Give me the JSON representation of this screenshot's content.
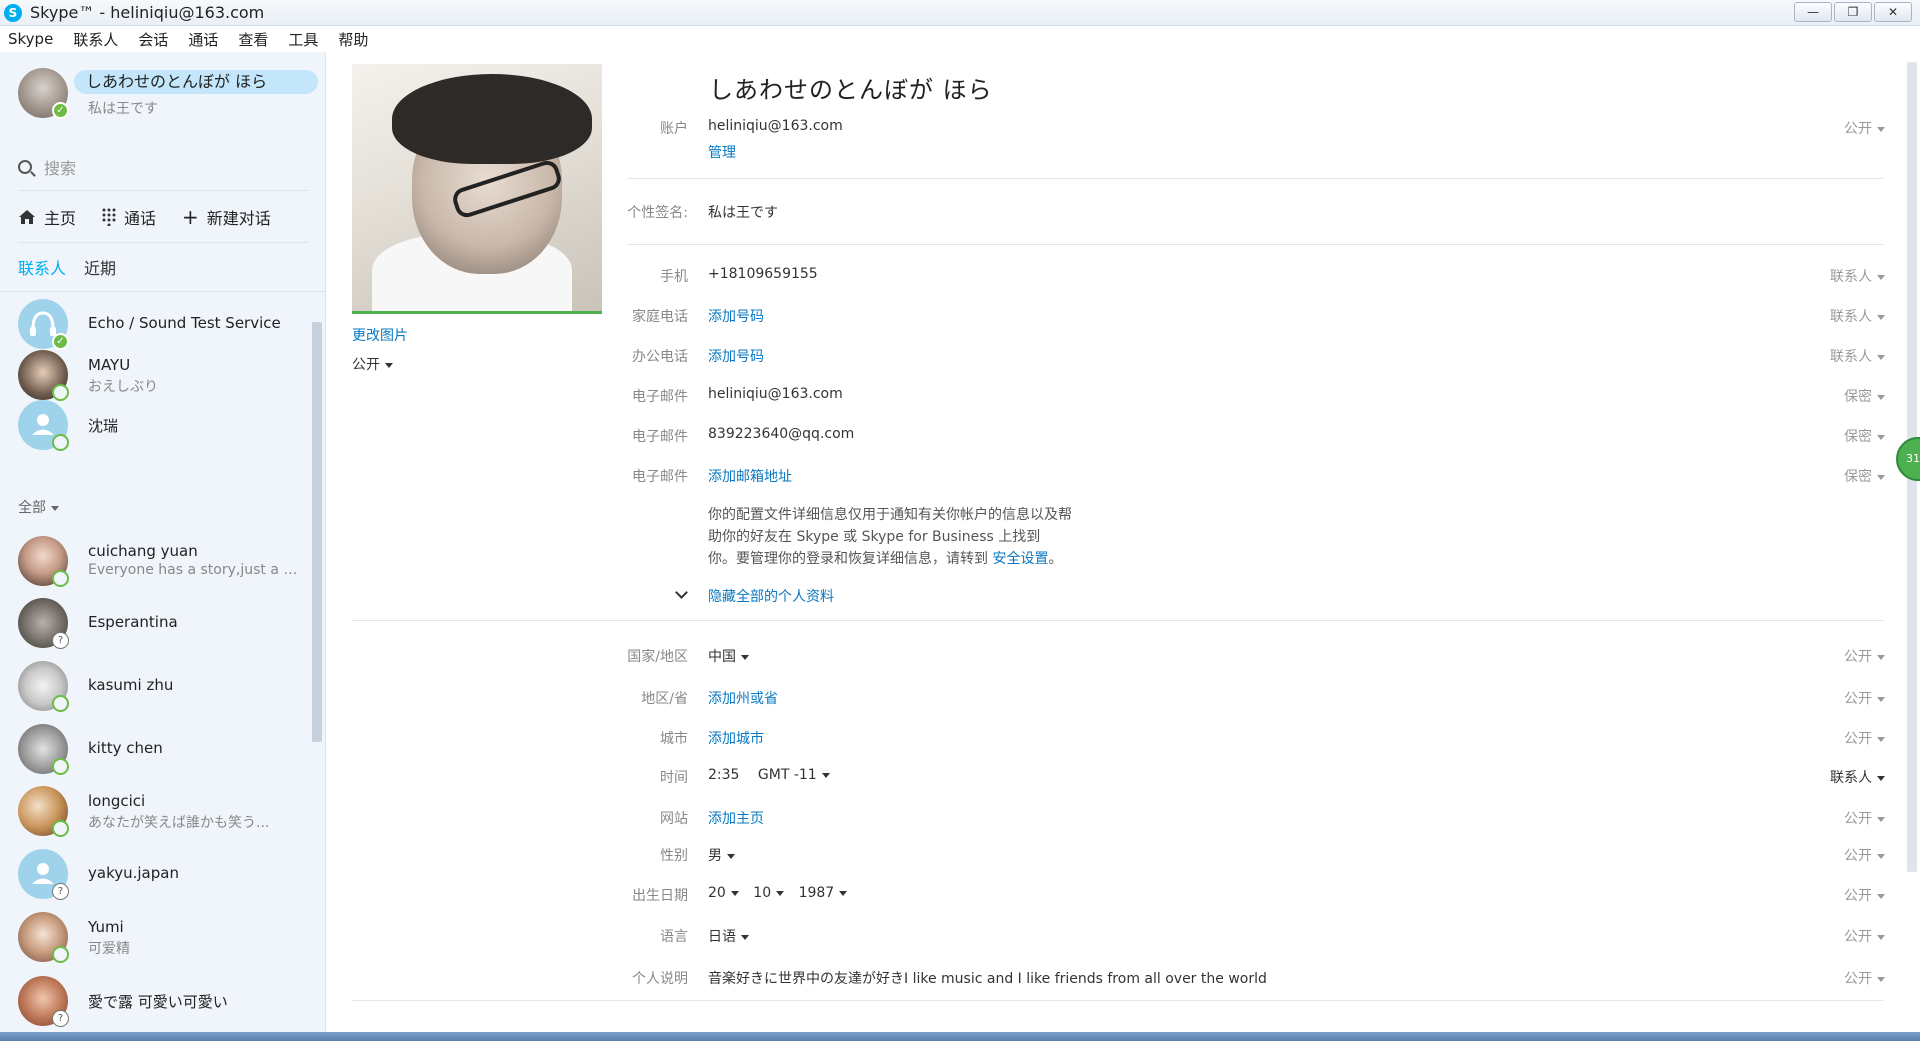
{
  "window": {
    "title": "Skype™ - heliniqiu@163.com",
    "logo_letter": "S",
    "controls": [
      "—",
      "❐",
      "✕"
    ]
  },
  "menu": [
    "Skype",
    "联系人",
    "会话",
    "通话",
    "查看",
    "工具",
    "帮助"
  ],
  "sidebar": {
    "me": {
      "name": "しあわせのとんぼが ほら",
      "mood": "私は王です"
    },
    "search_placeholder": "搜索",
    "nav": {
      "home": "主页",
      "calls": "通话",
      "new_chat": "新建对话"
    },
    "tabs": {
      "contacts": "联系人",
      "recent": "近期"
    },
    "favorites": [
      {
        "name": "Echo / Sound Test Service",
        "mood": "",
        "status": "online"
      },
      {
        "name": "MAYU",
        "mood": "おえしぶり",
        "status": "offline"
      },
      {
        "name": "沈瑞",
        "mood": "",
        "status": "offline"
      }
    ],
    "filter_label": "全部",
    "contacts": [
      {
        "name": "cuichang yuan",
        "mood": "Everyone has a story,just a di...",
        "status": "offline"
      },
      {
        "name": "Esperantina",
        "mood": "",
        "status": "unknown"
      },
      {
        "name": "kasumi zhu",
        "mood": "",
        "status": "offline"
      },
      {
        "name": "kitty chen",
        "mood": "",
        "status": "offline"
      },
      {
        "name": "longcici",
        "mood": "あなたが笑えば誰かも笑う...",
        "status": "offline"
      },
      {
        "name": "yakyu.japan",
        "mood": "",
        "status": "unknown"
      },
      {
        "name": "Yumi",
        "mood": "可爱精",
        "status": "offline"
      },
      {
        "name": "愛で露 可愛い可愛い",
        "mood": "",
        "status": "unknown"
      }
    ]
  },
  "profile": {
    "change_photo": "更改图片",
    "photo_privacy": "公开",
    "display_name": "しあわせのとんぼが ほら",
    "account": {
      "label": "账户",
      "value": "heliniqiu@163.com",
      "manage": "管理",
      "privacy": "公开"
    },
    "mood": {
      "label": "个性签名:",
      "value": "私は王です"
    },
    "phones": [
      {
        "label": "手机",
        "value": "+18109659155",
        "is_link": false,
        "privacy": "联系人"
      },
      {
        "label": "家庭电话",
        "value": "添加号码",
        "is_link": true,
        "privacy": "联系人"
      },
      {
        "label": "办公电话",
        "value": "添加号码",
        "is_link": true,
        "privacy": "联系人"
      }
    ],
    "emails": [
      {
        "label": "电子邮件",
        "value": "heliniqiu@163.com",
        "is_link": false,
        "privacy": "保密"
      },
      {
        "label": "电子邮件",
        "value": "839223640@qq.com",
        "is_link": false,
        "privacy": "保密"
      },
      {
        "label": "电子邮件",
        "value": "添加邮箱地址",
        "is_link": true,
        "privacy": "保密"
      }
    ],
    "info_lines": [
      "你的配置文件详细信息仅用于通知有关你帐户的信息以及帮",
      "助你的好友在 Skype 或 Skype for Business 上找到",
      "你。要管理你的登录和恢复详细信息，请转到 "
    ],
    "security_link": "安全设置",
    "info_end": "。",
    "hide_profile": "隐藏全部的个人资料",
    "details": {
      "country": {
        "label": "国家/地区",
        "value": "中国",
        "privacy": "公开"
      },
      "state": {
        "label": "地区/省",
        "value": "添加州或省",
        "privacy": "公开"
      },
      "city": {
        "label": "城市",
        "value": "添加城市",
        "privacy": "公开"
      },
      "time": {
        "label": "时间",
        "clock": "2:35",
        "tz": "GMT -11",
        "privacy": "联系人"
      },
      "website": {
        "label": "网站",
        "value": "添加主页",
        "privacy": "公开"
      },
      "gender": {
        "label": "性别",
        "value": "男",
        "privacy": "公开"
      },
      "birthday": {
        "label": "出生日期",
        "day": "20",
        "month": "10",
        "year": "1987",
        "privacy": "公开"
      },
      "language": {
        "label": "语言",
        "value": "日语",
        "privacy": "公开"
      },
      "about": {
        "label": "个人说明",
        "value": "音楽好きに世界中の友達が好きI like music and I like friends from all over the world",
        "privacy": "公开"
      }
    },
    "side_badge": "31"
  }
}
